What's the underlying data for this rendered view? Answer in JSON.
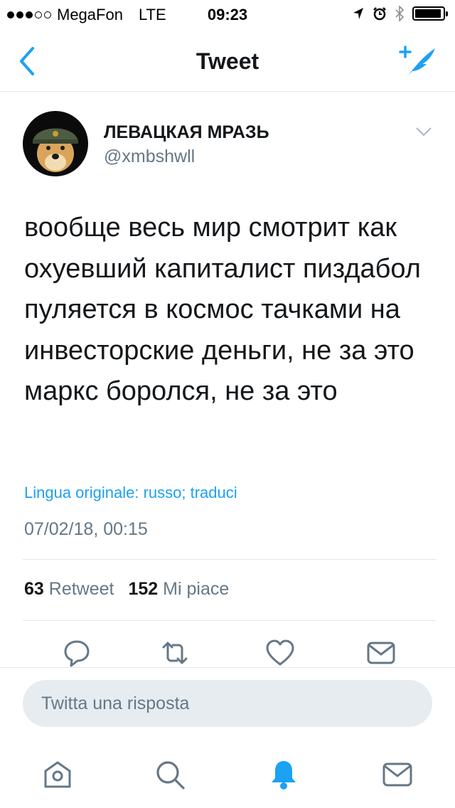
{
  "status_bar": {
    "carrier": "MegaFon",
    "network": "LTE",
    "time": "09:23",
    "signal_strength": 3,
    "signal_total": 5,
    "battery_level": 0.95
  },
  "nav": {
    "title": "Tweet",
    "back_icon": "chevron-left-icon",
    "compose_icon": "compose-tweet-icon"
  },
  "tweet": {
    "user_name": "ЛЕВАЦКАЯ МРАЗЬ",
    "user_handle": "@xmbshwll",
    "text": "вообще весь мир смотрит как охуевший капиталист пиздабол пуляется в космос тачками на инвесторские деньги, не за это маркс боролся, не за это",
    "translate_link": "Lingua originale: russo; traduci",
    "timestamp": "07/02/18, 00:15",
    "retweet_count": "63",
    "retweet_label": "Retweet",
    "like_count": "152",
    "like_label": "Mi piace"
  },
  "actions": [
    "reply-icon",
    "retweet-icon",
    "like-icon",
    "direct-message-icon"
  ],
  "reply_box": {
    "placeholder": "Twitta una risposta"
  },
  "tab_bar": [
    "home-icon",
    "search-icon",
    "notifications-icon",
    "messages-icon"
  ],
  "colors": {
    "accent": "#1da1f2",
    "text_primary": "#14171a",
    "text_secondary": "#657786",
    "divider": "#e1e8ed",
    "reply_box_bg": "#e6ecf0",
    "icon_gray": "#657786"
  }
}
